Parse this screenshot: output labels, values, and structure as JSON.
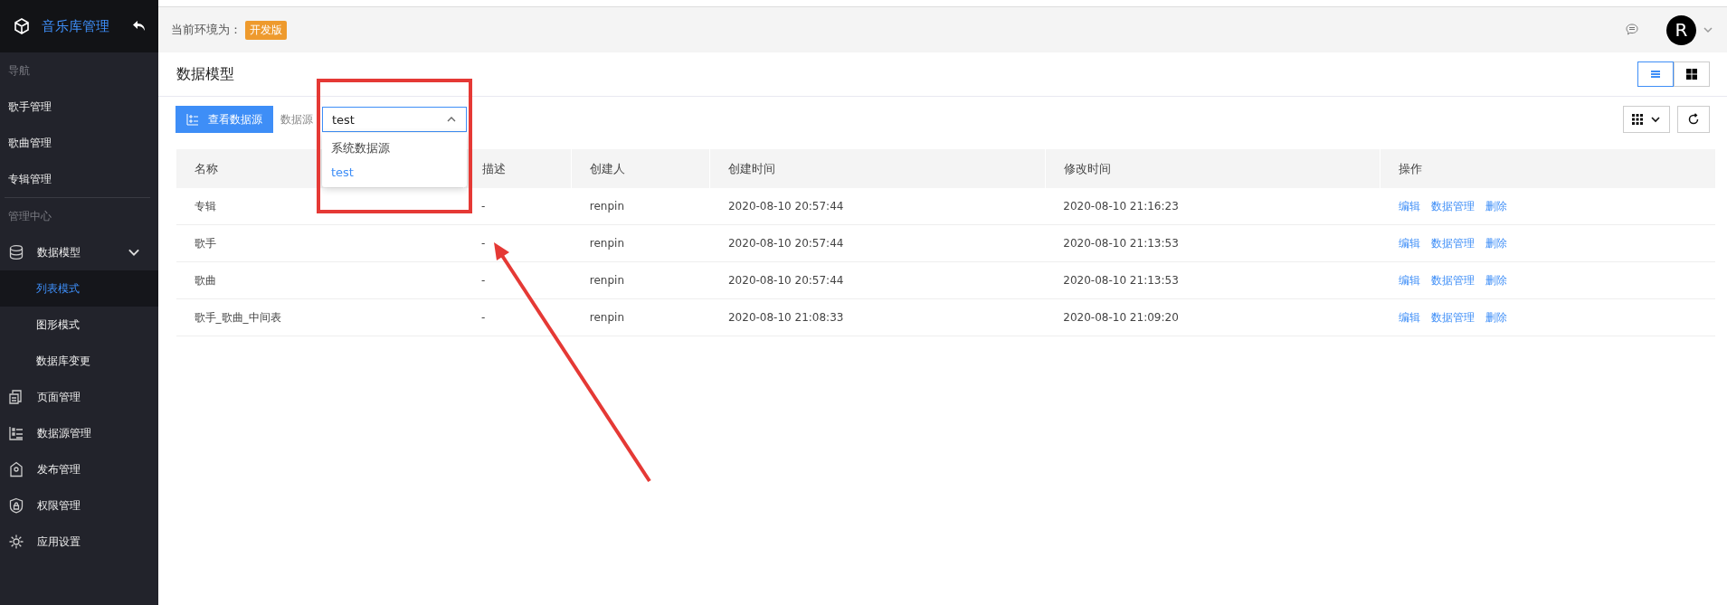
{
  "sidebar": {
    "brand": "音乐库管理",
    "sections": [
      {
        "title": "导航",
        "items": [
          {
            "label": "歌手管理",
            "selected": false
          },
          {
            "label": "歌曲管理",
            "selected": false
          },
          {
            "label": "专辑管理",
            "selected": false
          }
        ]
      },
      {
        "title": "管理中心",
        "items": [
          {
            "label": "数据模型",
            "selected": false,
            "expanded": true,
            "children": [
              {
                "label": "列表模式",
                "selected": true
              },
              {
                "label": "图形模式",
                "selected": false
              },
              {
                "label": "数据库变更",
                "selected": false
              }
            ]
          },
          {
            "label": "页面管理",
            "selected": false
          },
          {
            "label": "数据源管理",
            "selected": false
          },
          {
            "label": "发布管理",
            "selected": false
          },
          {
            "label": "权限管理",
            "selected": false
          },
          {
            "label": "应用设置",
            "selected": false
          }
        ]
      }
    ]
  },
  "header": {
    "env_label": "当前环境为：",
    "env_badge": "开发版",
    "avatar": "R"
  },
  "page_title": "数据模型",
  "view_toggle": [
    {
      "selected": true
    },
    {
      "selected": false
    }
  ],
  "toolbar": {
    "view_button": "查看数据源",
    "datasource_label": "数据源",
    "select": {
      "value": "test",
      "expanded": true,
      "options": [
        {
          "label": "系统数据源",
          "selected": false
        },
        {
          "label": "test",
          "selected": true
        }
      ]
    }
  },
  "table": {
    "columns": [
      "名称",
      "描述",
      "创建人",
      "创建时间",
      "修改时间",
      "操作"
    ],
    "rows": [
      {
        "cells": [
          "专辑",
          "-",
          "renpin",
          "2020-08-10 20:57:44",
          "2020-08-10 21:16:23"
        ],
        "actions": [
          "编辑",
          "数据管理",
          "删除"
        ]
      },
      {
        "cells": [
          "歌手",
          "-",
          "renpin",
          "2020-08-10 20:57:44",
          "2020-08-10 21:13:53"
        ],
        "actions": [
          "编辑",
          "数据管理",
          "删除"
        ]
      },
      {
        "cells": [
          "歌曲",
          "-",
          "renpin",
          "2020-08-10 20:57:44",
          "2020-08-10 21:13:53"
        ],
        "actions": [
          "编辑",
          "数据管理",
          "删除"
        ]
      },
      {
        "cells": [
          "歌手_歌曲_中间表",
          "-",
          "renpin",
          "2020-08-10 21:08:33",
          "2020-08-10 21:09:20"
        ],
        "actions": [
          "编辑",
          "数据管理",
          "删除"
        ]
      }
    ]
  }
}
